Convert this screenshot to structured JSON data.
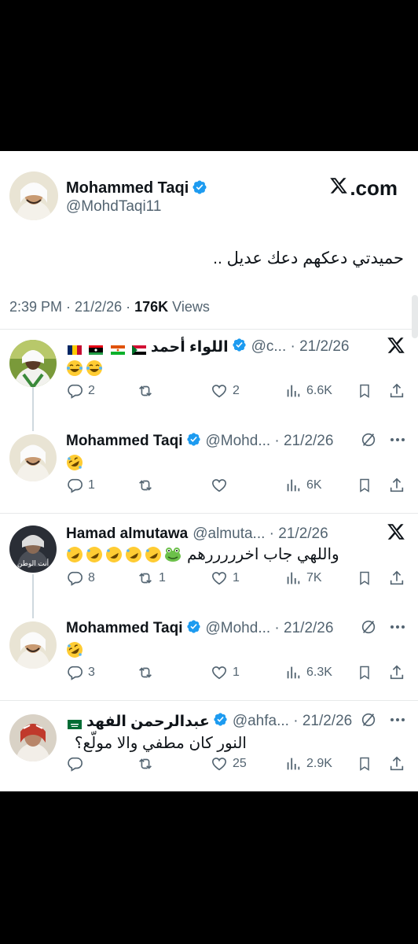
{
  "post": {
    "author_name": "Mohammed Taqi",
    "author_handle": "@MohdTaqi11",
    "brand": ".com",
    "text": "حميدتي دعكهم دعك عديل ..",
    "time": "2:39 PM",
    "date": "21/2/26",
    "views_count": "176K",
    "views_label": "Views"
  },
  "replies": [
    {
      "name": "اللواء أحمد",
      "handle": "@c...",
      "date": "21/2/26",
      "text": "",
      "emoji": [
        "face-with-tears-of-joy",
        "face-with-tears-of-joy"
      ],
      "flags": [
        "Chad",
        "Libya",
        "Niger",
        "Sudan"
      ],
      "corner_icon": "x-logo-icon",
      "counts": {
        "replies": "2",
        "reposts": "",
        "likes": "2",
        "views": "6.6K"
      }
    },
    {
      "name": "Mohammed Taqi",
      "handle": "@Mohd...",
      "date": "21/2/26",
      "text": "",
      "emoji": [
        "rolling-on-floor-laughing"
      ],
      "corner_icon": "grok-icon",
      "counts": {
        "replies": "1",
        "reposts": "",
        "likes": "",
        "views": "6K"
      }
    },
    {
      "name": "Hamad almutawa",
      "handle": "@almuta...",
      "date": "21/2/26",
      "text": "واللهي جاب اخرررررهم",
      "emoji": [
        "frog",
        "rolling-on-floor-laughing",
        "rolling-on-floor-laughing",
        "rolling-on-floor-laughing",
        "rolling-on-floor-laughing",
        "rolling-on-floor-laughing"
      ],
      "corner_icon": "x-logo-icon",
      "avatar_text": "أنت الوطن",
      "counts": {
        "replies": "8",
        "reposts": "1",
        "likes": "1",
        "views": "7K"
      }
    },
    {
      "name": "Mohammed Taqi",
      "handle": "@Mohd...",
      "date": "21/2/26",
      "text": "",
      "emoji": [
        "rolling-on-floor-laughing"
      ],
      "corner_icon": "grok-icon",
      "counts": {
        "replies": "3",
        "reposts": "",
        "likes": "1",
        "views": "6.3K"
      }
    },
    {
      "name": "عبدالرحمن الفهد",
      "handle": "@ahfa...",
      "date": "21/2/26",
      "text": "النور كان مطفي والا مولّع؟",
      "emoji": [],
      "flags": [
        "Saudi Arabia"
      ],
      "corner_icon": "grok-icon",
      "counts": {
        "replies": "",
        "reposts": "",
        "likes": "25",
        "views": "2.9K"
      }
    }
  ],
  "colors": {
    "verified": "#1d9bf0",
    "secondary_text": "#536471",
    "divider": "#e7e9ea"
  }
}
